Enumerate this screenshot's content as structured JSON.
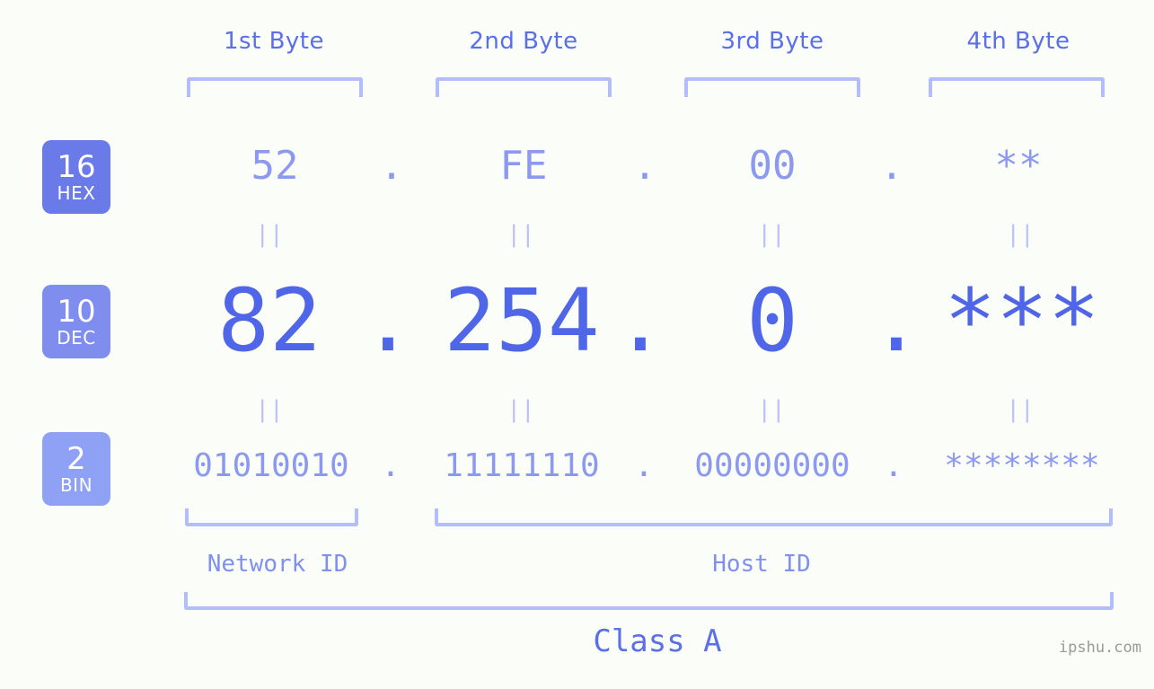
{
  "background_color": "#fbfdf8",
  "accent_colors": {
    "bracket": "#b3bdfb",
    "header_text": "#5a6fe8",
    "hex_text": "#8b99f0",
    "dec_text": "#4f66e8",
    "bin_text": "#8b99f0",
    "badge_hex": "#6a7be9",
    "badge_dec": "#7f8dee",
    "badge_bin": "#8fa1f4",
    "equals": "#b9c2fb",
    "watermark": "#9a9a9a"
  },
  "byte_headers": [
    {
      "label": "1st Byte"
    },
    {
      "label": "2nd Byte"
    },
    {
      "label": "3rd Byte"
    },
    {
      "label": "4th Byte"
    }
  ],
  "bases": [
    {
      "number": "16",
      "abbr": "HEX"
    },
    {
      "number": "10",
      "abbr": "DEC"
    },
    {
      "number": "2",
      "abbr": "BIN"
    }
  ],
  "rows": {
    "hex": {
      "base_number": "16",
      "base_abbr": "HEX",
      "values": [
        "52",
        "FE",
        "00",
        "**"
      ],
      "separator": "."
    },
    "dec": {
      "base_number": "10",
      "base_abbr": "DEC",
      "values": [
        "82",
        "254",
        "0",
        "***"
      ],
      "separator": "."
    },
    "bin": {
      "base_number": "2",
      "base_abbr": "BIN",
      "values": [
        "01010010",
        "11111110",
        "00000000",
        "********"
      ],
      "separator": "."
    }
  },
  "equals_symbol": "||",
  "sections": {
    "network_id": "Network ID",
    "host_id": "Host ID",
    "class": "Class A"
  },
  "watermark": "ipshu.com"
}
